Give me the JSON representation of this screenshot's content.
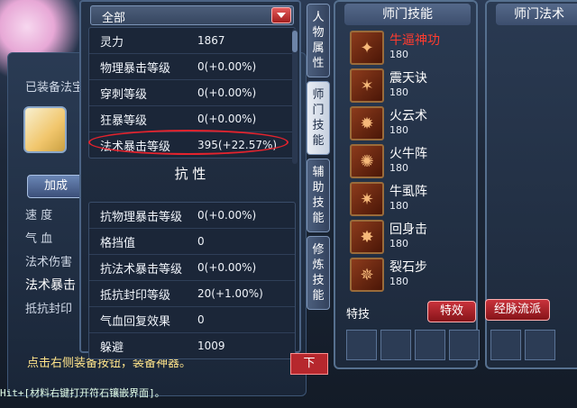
{
  "background": {
    "equipped_label": "已装备法宝",
    "enhance_button": "加成",
    "stats_left": [
      "速 度",
      "气 血",
      "法术伤害",
      "法术暴击",
      "抵抗封印"
    ],
    "hint": "点击右侧装备按钮，装备神器。",
    "bottom_line": "Hit+[材料右键打开符石镶嵌界面]。"
  },
  "attr_panel": {
    "dropdown_value": "全部",
    "rows_top": [
      {
        "name": "灵力",
        "value": "1867"
      },
      {
        "name": "物理暴击等级",
        "value": "0(+0.00%)"
      },
      {
        "name": "穿刺等级",
        "value": "0(+0.00%)"
      },
      {
        "name": "狂暴等级",
        "value": "0(+0.00%)"
      },
      {
        "name": "法术暴击等级",
        "value": "395(+22.57%)"
      }
    ],
    "section_title": "抗 性",
    "rows_bottom": [
      {
        "name": "抗物理暴击等级",
        "value": "0(+0.00%)"
      },
      {
        "name": "格挡值",
        "value": "0"
      },
      {
        "name": "抗法术暴击等级",
        "value": "0(+0.00%)"
      },
      {
        "name": "抵抗封印等级",
        "value": "20(+1.00%)"
      },
      {
        "name": "气血回复效果",
        "value": "0"
      },
      {
        "name": "躲避",
        "value": "1009"
      }
    ],
    "bottom_button": "下"
  },
  "tabs": [
    "人物属性",
    "师门技能",
    "辅助技能",
    "修炼技能"
  ],
  "skills_panel": {
    "title": "师门技能",
    "skills": [
      {
        "name": "牛逼神功",
        "level": "180",
        "icon": "bull-icon",
        "glyph": "✦"
      },
      {
        "name": "震天诀",
        "level": "180",
        "icon": "quake-icon",
        "glyph": "✶"
      },
      {
        "name": "火云术",
        "level": "180",
        "icon": "flame-cloud-icon",
        "glyph": "✹"
      },
      {
        "name": "火牛阵",
        "level": "180",
        "icon": "fire-bull-icon",
        "glyph": "✺"
      },
      {
        "name": "牛虱阵",
        "level": "180",
        "icon": "bull-formation-icon",
        "glyph": "✷"
      },
      {
        "name": "回身击",
        "level": "180",
        "icon": "spin-strike-icon",
        "glyph": "✸"
      },
      {
        "name": "裂石步",
        "level": "180",
        "icon": "stone-step-icon",
        "glyph": "✵"
      }
    ],
    "special_label": "特技",
    "effect_button": "特效",
    "meridian_button": "经脉流派"
  },
  "skills2_panel": {
    "title": "师门法术"
  },
  "colors": {
    "highlight": "#e3232d",
    "first_skill": "#ff3c2f"
  }
}
